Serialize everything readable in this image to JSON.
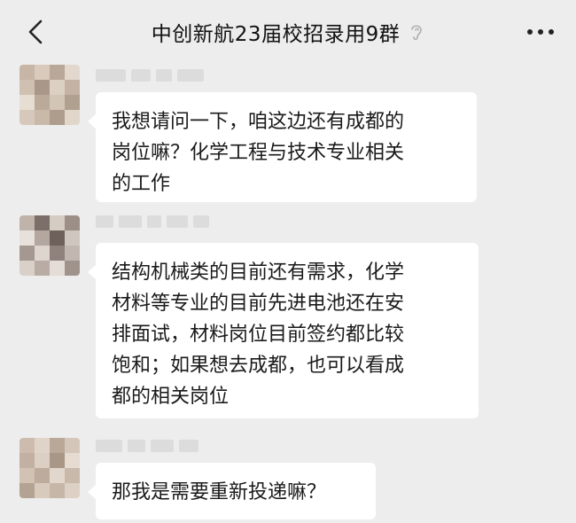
{
  "header": {
    "back_icon": "chevron-left-icon",
    "title": "中创新航23届校招录用9群",
    "muted_icon": "ear-icon",
    "more_label": "···"
  },
  "messages": [
    {
      "lines": [
        "我想请问一下，咱这边还有成都的",
        "岗位嘛？化学工程与技术专业相关",
        "的工作"
      ]
    },
    {
      "lines": [
        "结构机械类的目前还有需求，化学",
        "材料等专业的目前先进电池还在安",
        "排面试，材料岗位目前签约都比较",
        "饱和；如果想去成都，也可以看成",
        "都的相关岗位"
      ]
    },
    {
      "lines": [
        "那我是需要重新投递嘛？"
      ]
    }
  ]
}
